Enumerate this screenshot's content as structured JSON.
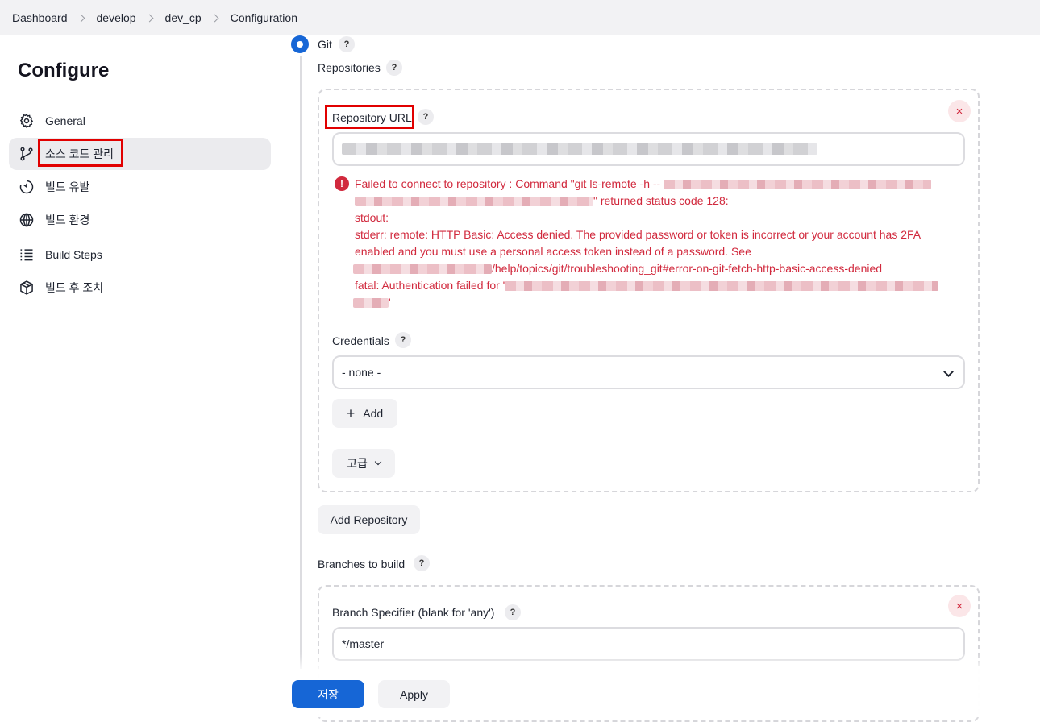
{
  "breadcrumb": [
    "Dashboard",
    "develop",
    "dev_cp",
    "Configuration"
  ],
  "sidebar": {
    "title": "Configure",
    "items": [
      {
        "label": "General",
        "icon": "gear-icon"
      },
      {
        "label": "소스 코드 관리",
        "icon": "branch-icon",
        "active": true
      },
      {
        "label": "빌드 유발",
        "icon": "timer-icon"
      },
      {
        "label": "빌드 환경",
        "icon": "globe-icon"
      },
      {
        "label": "Build Steps",
        "icon": "list-icon"
      },
      {
        "label": "빌드 후 조치",
        "icon": "package-icon"
      }
    ]
  },
  "scm": {
    "option_label": "Git",
    "help": "?",
    "repositories_label": "Repositories",
    "repository_url_label": "Repository URL",
    "error": {
      "line1": "Failed to connect to repository : Command \"git ls-remote -h --",
      "line2_suffix": "\" returned status code 128:",
      "line3": "stdout:",
      "line4": "stderr: remote: HTTP Basic: Access denied. The provided password or token is incorrect or your account has 2FA",
      "line5": "enabled and you must use a personal access token instead of a password. See",
      "line6_suffix": "/help/topics/git/troubleshooting_git#error-on-git-fetch-http-basic-access-denied",
      "line7": "fatal: Authentication failed for '",
      "line8_suffix": "'"
    },
    "credentials_label": "Credentials",
    "credentials_value": "- none -",
    "add_label": "Add",
    "advanced_label": "고급",
    "add_repository_label": "Add Repository",
    "branches_label": "Branches to build",
    "branch_specifier_label": "Branch Specifier (blank for 'any')",
    "branch_specifier_value": "*/master",
    "remove_glyph": "×"
  },
  "footer": {
    "save_label": "저장",
    "apply_label": "Apply"
  },
  "colors": {
    "primary": "#1666d6",
    "error": "#d1293d",
    "highlight": "#e10000"
  }
}
